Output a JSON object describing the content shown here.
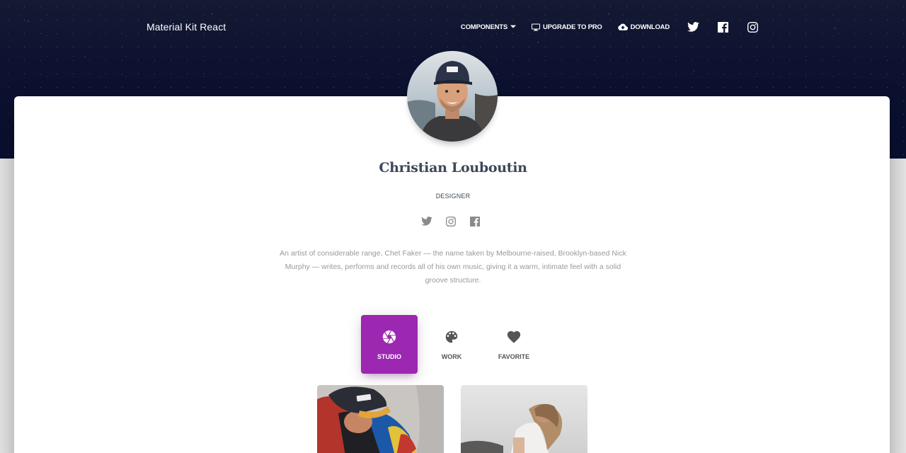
{
  "navbar": {
    "brand": "Material Kit React",
    "items": [
      {
        "label": "Components",
        "icon": "chevron-down-icon"
      },
      {
        "label": "Upgrade to PRO",
        "icon": "monitor-icon"
      },
      {
        "label": "Download",
        "icon": "cloud-download-icon"
      }
    ],
    "social": [
      "twitter-icon",
      "facebook-icon",
      "instagram-icon"
    ]
  },
  "profile": {
    "name": "Christian Louboutin",
    "role": "DESIGNER",
    "social": [
      "twitter-icon",
      "instagram-icon",
      "facebook-icon"
    ],
    "bio": "An artist of considerable range, Chet Faker — the name taken by Melbourne-raised, Brooklyn-based Nick Murphy — writes, performs and records all of his own music, giving it a warm, intimate feel with a solid groove structure."
  },
  "tabs": [
    {
      "label": "STUDIO",
      "icon": "camera-aperture-icon",
      "active": true
    },
    {
      "label": "WORK",
      "icon": "palette-icon",
      "active": false
    },
    {
      "label": "FAVORITE",
      "icon": "heart-icon",
      "active": false
    }
  ],
  "colors": {
    "accent": "#9c27b0",
    "hero_dark": "#0d1230",
    "title": "#3c4858"
  }
}
